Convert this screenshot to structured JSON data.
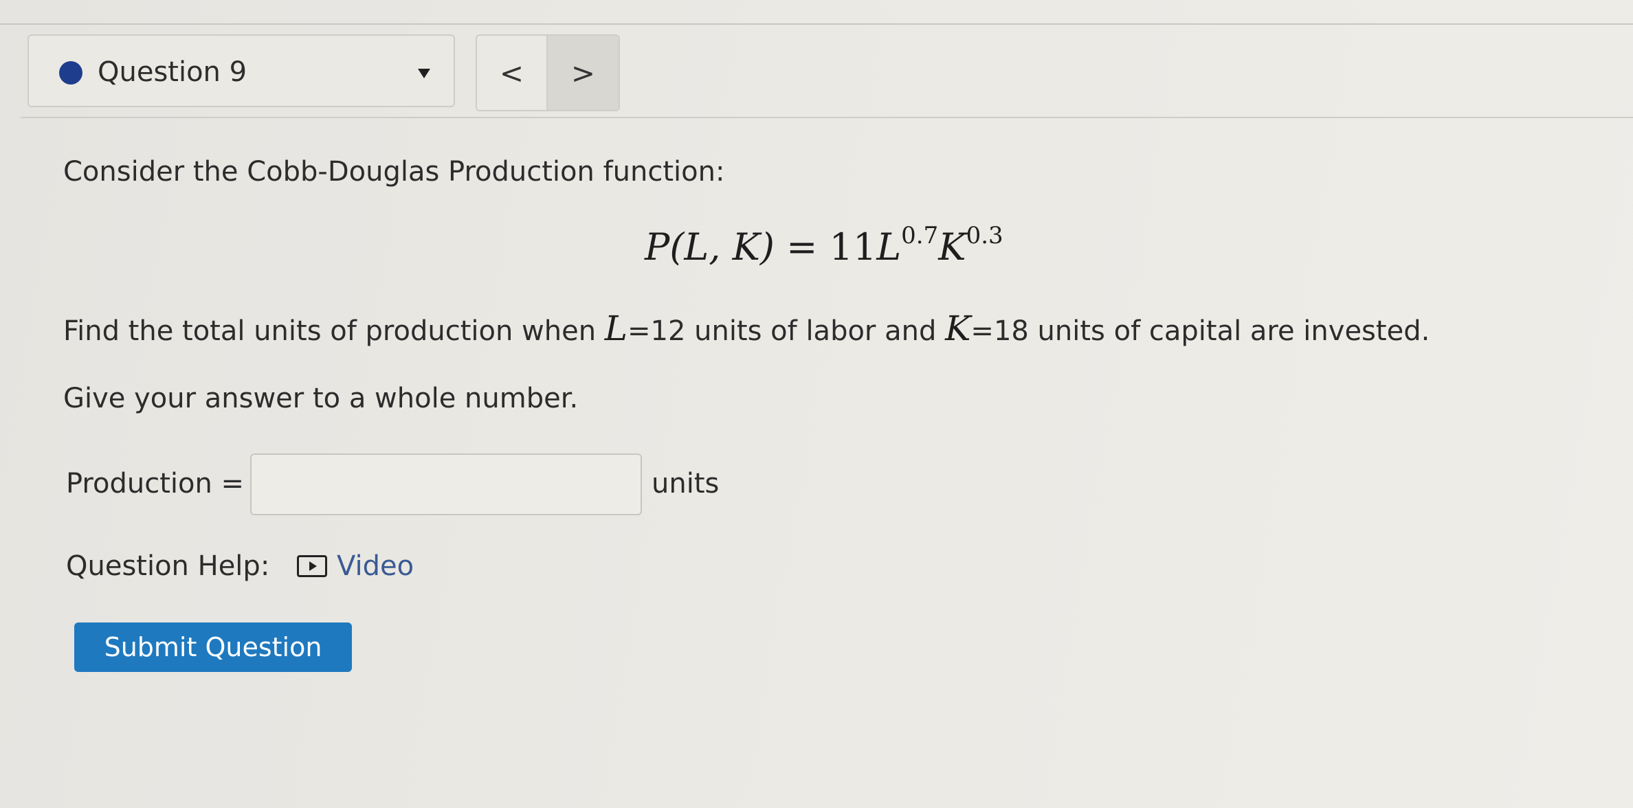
{
  "nav": {
    "question_label": "Question 9",
    "prev_label": "<",
    "next_label": ">",
    "status_color": "#1e3d8c"
  },
  "question": {
    "intro": "Consider the Cobb-Douglas Production function:",
    "formula": {
      "lhs": "P(L, K)",
      "equals": "=",
      "coefficient": "11",
      "var1": "L",
      "exp1": "0.7",
      "var2": "K",
      "exp2": "0.3"
    },
    "find": {
      "part1": "Find the total units of production when ",
      "var_l": "L",
      "part2": "=12 units of labor and ",
      "var_k": "K",
      "part3": "=18 units of capital are invested."
    },
    "instruction": "Give your answer to a whole number."
  },
  "answer": {
    "label": "Production =",
    "value": "",
    "units": "units"
  },
  "help": {
    "label": "Question Help:",
    "video_label": "Video",
    "link_color": "#3a5a94"
  },
  "submit": {
    "label": "Submit Question",
    "color": "#1f79bf"
  }
}
